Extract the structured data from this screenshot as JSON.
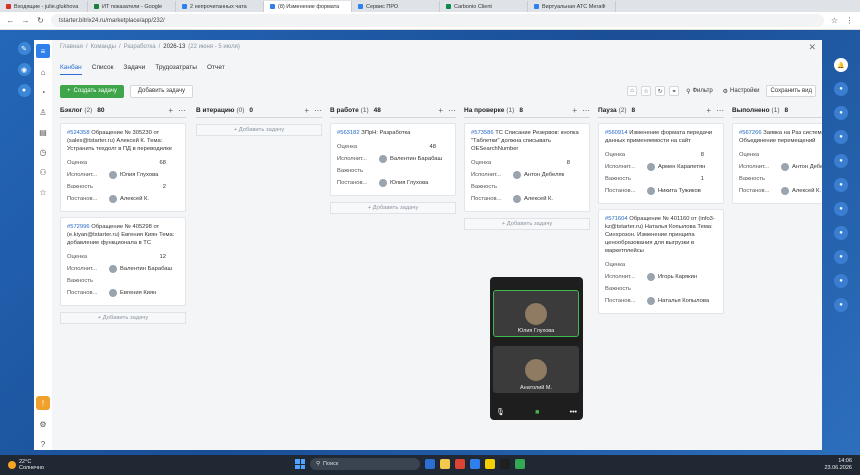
{
  "browser": {
    "tabs": [
      {
        "label": "Входящие - julie.glukhova",
        "color": "#d93025",
        "active": false
      },
      {
        "label": "ИТ показатели - Google",
        "color": "#188038",
        "active": false
      },
      {
        "label": "2 непрочитанных чата",
        "color": "#2f80ed",
        "active": false
      },
      {
        "label": "(8) Изменение формата",
        "color": "#2f80ed",
        "active": true
      },
      {
        "label": "Сервис ПРО",
        "color": "#2f80ed",
        "active": false
      },
      {
        "label": "Carbonio Client",
        "color": "#0b8a4c",
        "active": false
      },
      {
        "label": "Виртуальная АТС МегаФ",
        "color": "#2f80ed",
        "active": false
      }
    ],
    "url": "tstarter.bitrix24.ru/marketplace/app/232/"
  },
  "breadcrumb": {
    "items": [
      "Главная",
      "Команды",
      "Разработка"
    ],
    "current": "2026-13",
    "range": "(22 июня - 5 июля)"
  },
  "tabs": [
    "Канбан",
    "Список",
    "Задачи",
    "Трудозатраты",
    "Отчет"
  ],
  "toolbar": {
    "create_label": "Создать задачу",
    "add_label": "Добавить задачу",
    "filter_label": "Фильтр",
    "settings_label": "Настройки",
    "save_view_label": "Сохранить вид"
  },
  "labels": {
    "estimate": "Оценка",
    "assignee": "Исполнит...",
    "importance": "Важность",
    "setter": "Постанов...",
    "add_task": "+ Добавить задачу"
  },
  "columns": [
    {
      "title": "Бэклог",
      "count": "(2)",
      "extra": "80",
      "show_add": true,
      "cards": [
        {
          "num": "#524358",
          "text": "Обращение № 305230 от (sales@tstarter.ru) Алексей К. Тема: Устранить техдолг в ПД в переводилке",
          "estimate": "68",
          "assignee": "Юлия Глухова",
          "importance": "2",
          "setter": "Алексей К."
        },
        {
          "num": "#572996",
          "text": "Обращение № 405298 от (e.kiyan@tstarter.ru) Евгения Киян Тема: добавление функционала в ТС",
          "estimate": "12",
          "assignee": "Валентин Барабаш",
          "importance": "",
          "setter": "Евгения Киян"
        }
      ]
    },
    {
      "title": "В итерацию",
      "count": "(0)",
      "extra": "0",
      "show_add": true,
      "cards": []
    },
    {
      "title": "В работе",
      "count": "(1)",
      "extra": "48",
      "show_add": true,
      "cards": [
        {
          "num": "#563182",
          "text": "ЗПрН: Разработка",
          "estimate": "48",
          "assignee": "Валентин Барабаш",
          "importance": "",
          "setter": "Юлия Глухова"
        }
      ]
    },
    {
      "title": "На проверке",
      "count": "(1)",
      "extra": "8",
      "show_add": true,
      "cards": [
        {
          "num": "#573586",
          "text": "ТС Списание Резервов: кнопка \"Таблетки\" должна списывать OESearchNumber",
          "estimate": "8",
          "assignee": "Антон Дебеляк",
          "importance": "",
          "setter": "Алексей К."
        }
      ]
    },
    {
      "title": "Пауза",
      "count": "(2)",
      "extra": "8",
      "show_add": false,
      "cards": [
        {
          "num": "#560914",
          "text": "Изменение формата передачи данных применяемости на сайт",
          "estimate": "8",
          "assignee": "Армен Карапетян",
          "importance": "1",
          "setter": "Никита Тужиков"
        },
        {
          "num": "#571604",
          "text": "Обращение № 401160 от (info3-kz@tstarter.ru) Наталья Копылова Тема: Синхрозон. Изменение принципа ценообразования для выгрузки в маркетплейсы",
          "estimate": "",
          "assignee": "Игорь Карякин",
          "importance": "",
          "setter": "Наталья Копылова"
        }
      ]
    },
    {
      "title": "Выполнено",
      "count": "(1)",
      "extra": "8",
      "show_add": false,
      "cards": [
        {
          "num": "#567266",
          "text": "Заявка на Раз систем. Тема: Объединение перемещений",
          "estimate": "",
          "assignee": "Антон Дебеляк",
          "importance": "",
          "setter": "Алексей К."
        }
      ]
    }
  ],
  "video_call": {
    "participants": [
      "Юлия Глухова",
      "Анатолий М."
    ]
  },
  "taskbar": {
    "weather_temp": "22°C",
    "weather_desc": "Солнечно",
    "search_placeholder": "Поиск",
    "time": "14:06",
    "date": "23.06.2026"
  }
}
